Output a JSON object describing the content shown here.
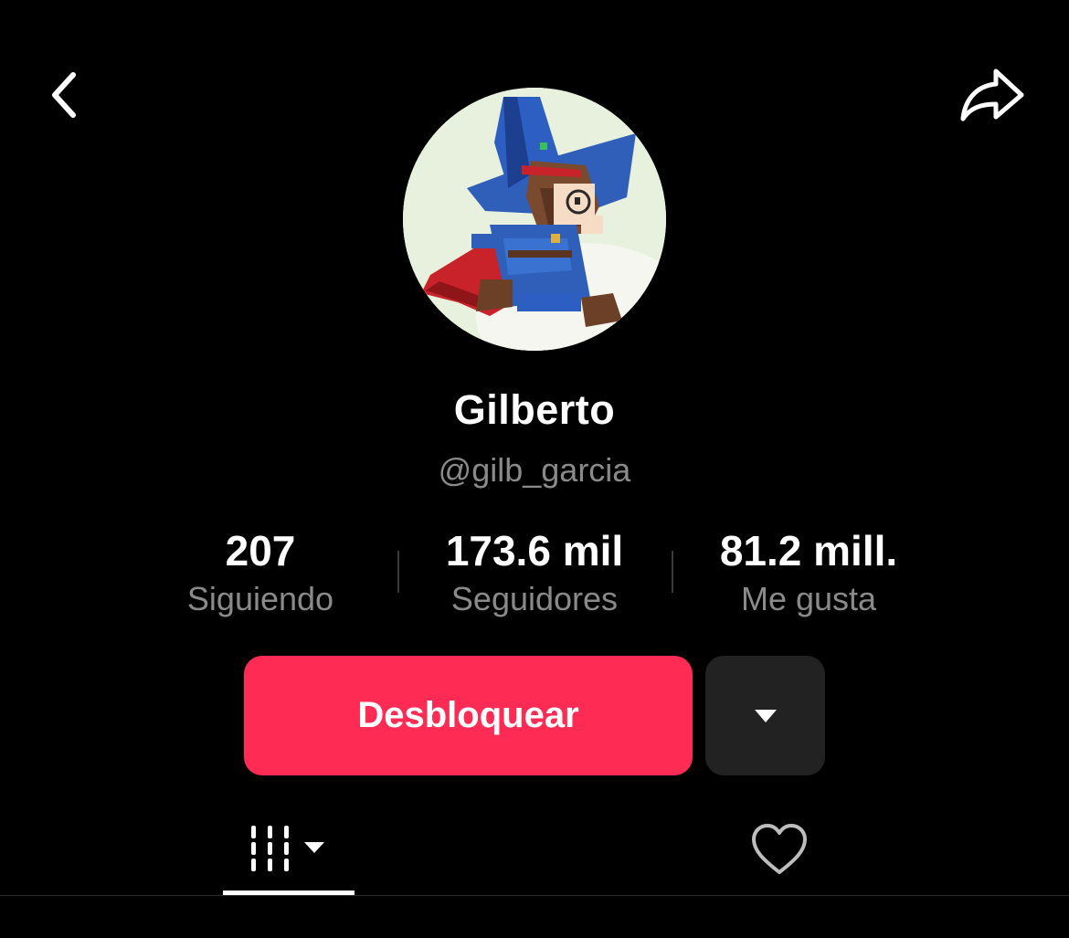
{
  "header": {
    "back_icon": "chevron-left-icon",
    "share_icon": "share-arrow-icon"
  },
  "profile": {
    "display_name": "Gilberto",
    "handle": "@gilb_garcia",
    "avatar_description_icon": "pixel-art-wizard-avatar"
  },
  "stats": [
    {
      "value": "207",
      "label": "Siguiendo"
    },
    {
      "value": "173.6 mil",
      "label": "Seguidores"
    },
    {
      "value": "81.2 mill.",
      "label": "Me gusta"
    }
  ],
  "actions": {
    "primary_label": "Desbloquear",
    "primary_color": "#fe2c55",
    "more_icon": "caret-down-icon"
  },
  "tabs": {
    "videos_icon": "video-grid-icon",
    "liked_icon": "heart-outline-icon",
    "active": "videos"
  }
}
